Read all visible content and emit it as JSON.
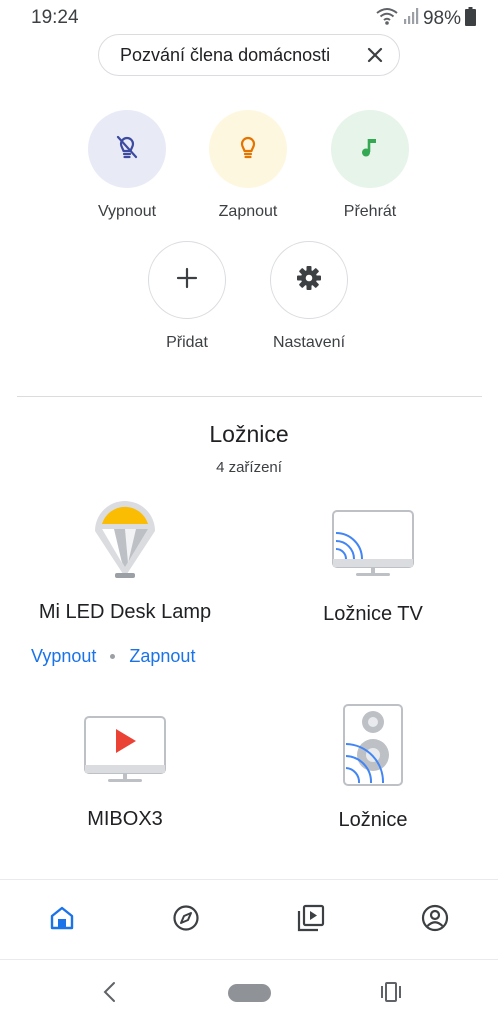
{
  "status_bar": {
    "time": "19:24",
    "battery": "98%"
  },
  "invite_chip": {
    "label": "Pozvání člena domácnosti"
  },
  "actions": [
    {
      "label": "Vypnout",
      "icon": "light-off-icon",
      "color": "#e8eaf6"
    },
    {
      "label": "Zapnout",
      "icon": "lightbulb-icon",
      "color": "#fef7e0"
    },
    {
      "label": "Přehrát",
      "icon": "music-note-icon",
      "color": "#e6f4ea"
    },
    {
      "label": "Přidat",
      "icon": "plus-icon"
    },
    {
      "label": "Nastavení",
      "icon": "gear-icon"
    }
  ],
  "room": {
    "name": "Ložnice",
    "device_count": "4 zařízení",
    "devices": [
      {
        "name": "Mi LED Desk Lamp",
        "icon": "lamp-icon"
      },
      {
        "name": "Ložnice TV",
        "icon": "cast-tv-icon"
      },
      {
        "name": "MIBOX3",
        "icon": "tv-play-icon"
      },
      {
        "name": "Ložnice",
        "icon": "speaker-icon"
      }
    ],
    "lamp_actions": {
      "off": "Vypnout",
      "on": "Zapnout"
    }
  },
  "bottom_nav": [
    {
      "icon": "home-icon",
      "active": true
    },
    {
      "icon": "compass-icon"
    },
    {
      "icon": "media-icon"
    },
    {
      "icon": "account-icon"
    }
  ],
  "colors": {
    "accent": "#1a73e8",
    "lamp_yellow": "#fbbc04",
    "play_red": "#ea4335",
    "music_green": "#34a853",
    "bulb_amber": "#e37400"
  }
}
